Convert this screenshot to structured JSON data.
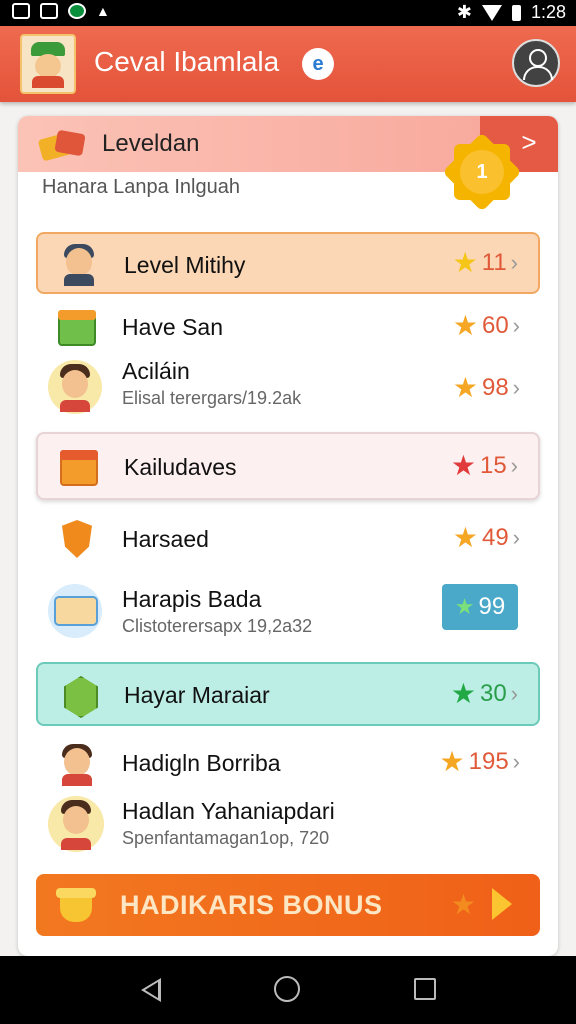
{
  "status_bar": {
    "time": "1:28"
  },
  "app_bar": {
    "title": "Ceval Ibamlala",
    "badge": "e"
  },
  "card": {
    "header_title": "Leveldan",
    "header_arrow": ">",
    "medal_number": "1",
    "subtitle": "Hanara Lanpa Inlguah"
  },
  "rows": [
    {
      "title": "Level Mitihy",
      "subtitle": "",
      "score": "11",
      "star_color": "#f5c518",
      "score_color": "#e05a3a",
      "icon": "ninja-icon"
    },
    {
      "title": "Have San",
      "subtitle": "",
      "score": "60",
      "star_color": "#f5a623",
      "score_color": "#e05a3a",
      "icon": "map-icon"
    },
    {
      "title": "Aciláin",
      "subtitle": "Elisal terergars/19.2ak",
      "score": "98",
      "star_color": "#f5a623",
      "score_color": "#e05a3a",
      "icon": "avatar-icon"
    },
    {
      "title": "Kailudaves",
      "subtitle": "",
      "score": "15",
      "star_color": "#e23b3b",
      "score_color": "#e05a3a",
      "icon": "gift-box-icon"
    },
    {
      "title": "Harsaed",
      "subtitle": "",
      "score": "49",
      "star_color": "#f5a623",
      "score_color": "#e05a3a",
      "icon": "shield-icon"
    },
    {
      "title": "Harapis Bada",
      "subtitle": "Clistoterersapx 19,2a32",
      "score": "99",
      "star_color": "#7be07b",
      "score_color": "#ffffff",
      "icon": "ticket-icon"
    },
    {
      "title": "Hayar Maraiar",
      "subtitle": "",
      "score": "30",
      "star_color": "#22a845",
      "score_color": "#2a9d4a",
      "icon": "gem-icon"
    },
    {
      "title": "Hadigln Borriba",
      "subtitle": "",
      "score": "195",
      "star_color": "#f5a623",
      "score_color": "#e05a3a",
      "icon": "character-icon"
    },
    {
      "title": "Hadlan Yahaniapdari",
      "subtitle": "Spenfantamagan1op, 720",
      "score": "",
      "star_color": "",
      "score_color": "",
      "icon": "avatar-icon"
    }
  ],
  "bonus_button": {
    "label": "HADIKARIS BONUS"
  }
}
